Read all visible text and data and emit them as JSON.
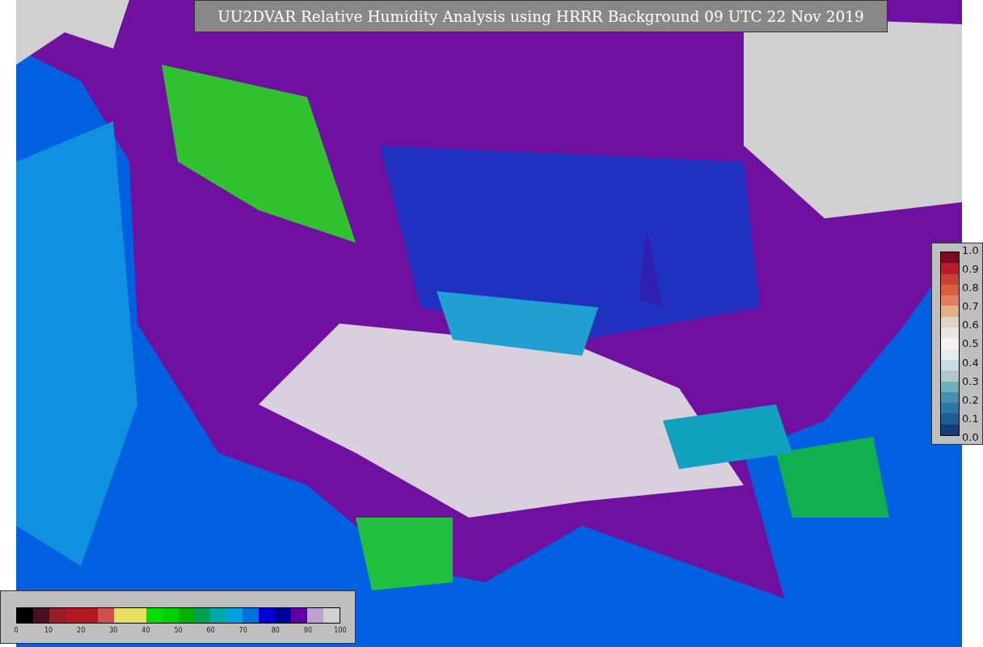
{
  "title": "UU2DVAR Relative Humidity Analysis using HRRR Background 09 UTC 22 Nov 2019",
  "humidity_colorbar": {
    "ticks": [
      "0",
      "10",
      "20",
      "30",
      "40",
      "50",
      "60",
      "70",
      "80",
      "90",
      "100"
    ]
  },
  "ratio_colorbar": {
    "ticks": [
      "1.0",
      "0.9",
      "0.8",
      "0.7",
      "0.6",
      "0.5",
      "0.4",
      "0.3",
      "0.2",
      "0.1",
      "0.0"
    ]
  }
}
